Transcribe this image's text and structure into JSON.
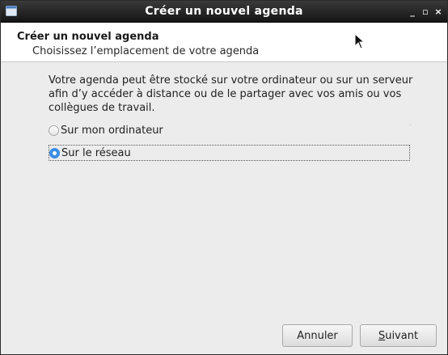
{
  "window": {
    "title": "Créer un nouvel agenda",
    "buttons": {
      "minimize": "_",
      "maximize": "▫",
      "close": "×"
    }
  },
  "header": {
    "title": "Créer un nouvel agenda",
    "subtitle": "Choisissez l’emplacement de votre agenda"
  },
  "body": {
    "description": "Votre agenda peut être stocké sur votre ordinateur ou sur un serveur afin d’y accéder à distance ou de le partager avec vos amis ou vos collègues de travail.",
    "options": [
      {
        "label": "Sur mon ordinateur",
        "selected": false
      },
      {
        "label": "Sur le réseau",
        "selected": true
      }
    ]
  },
  "footer": {
    "cancel_label": "Annuler",
    "next_label_mnemonic": "S",
    "next_label_rest": "uivant"
  },
  "colors": {
    "accent": "#3a8ee6",
    "titlebar": "#1f1f1f"
  },
  "icons": {
    "app": "calendar-app-icon",
    "cursor": "mouse-pointer-icon"
  }
}
